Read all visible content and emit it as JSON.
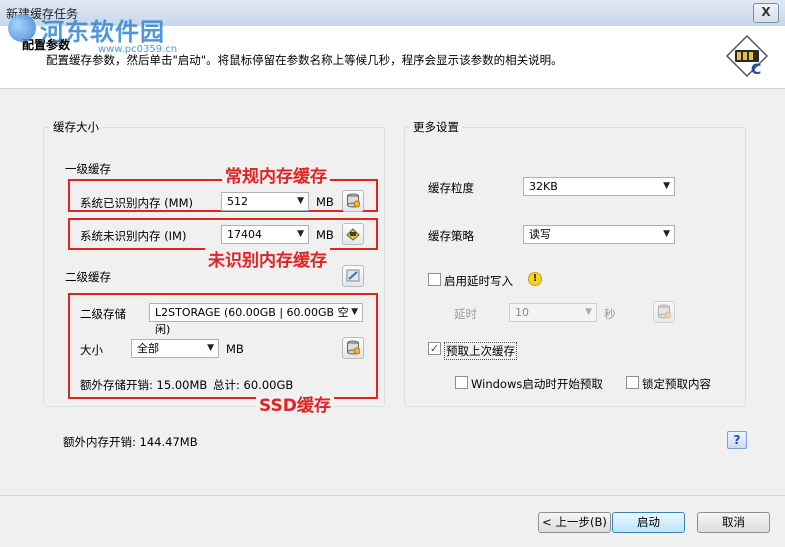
{
  "window": {
    "title": "新建缓存任务",
    "close_label": "X"
  },
  "watermark": {
    "text": "河东软件园",
    "sub": "www.pc0359.cn"
  },
  "header": {
    "title": "配置参数",
    "description": "配置缓存参数，然后单击\"启动\"。将鼠标停留在参数名称上等候几秒，程序会显示该参数的相关说明。",
    "icon": "cache-card-icon"
  },
  "cache_size": {
    "group_title": "缓存大小",
    "level1_label": "一级缓存",
    "recognized_label": "系统已识别内存 (MM)",
    "recognized_value": "512",
    "recognized_unit": "MB",
    "unrecognized_label": "系统未识别内存 (IM)",
    "unrecognized_value": "17404",
    "unrecognized_unit": "MB",
    "level2_label": "二级缓存",
    "storage_label": "二级存储",
    "storage_value": "L2STORAGE (60.00GB | 60.00GB 空闲)",
    "size_label": "大小",
    "size_value": "全部",
    "size_unit": "MB",
    "extra_storage_text": "额外存储开销: 15.00MB",
    "total_text": "总计: 60.00GB"
  },
  "annotations": {
    "regular_memory": "常规内存缓存",
    "unrecognized_memory": "未识别内存缓存",
    "ssd": "SSD缓存"
  },
  "more_settings": {
    "group_title": "更多设置",
    "granularity_label": "缓存粒度",
    "granularity_value": "32KB",
    "strategy_label": "缓存策略",
    "strategy_value": "读写",
    "delayed_write_label": "启用延时写入",
    "delayed_write_checked": false,
    "delay_label": "延时",
    "delay_value": "10",
    "delay_unit": "秒",
    "prefetch_label": "预取上次缓存",
    "prefetch_checked": true,
    "windows_start_label": "Windows启动时开始预取",
    "windows_start_checked": false,
    "lock_prefetch_label": "锁定预取内容",
    "lock_prefetch_checked": false
  },
  "extra_memory_text": "额外内存开销: 144.47MB",
  "help_label": "?",
  "footer": {
    "back_label": "< 上一步(B)",
    "start_label": "启动",
    "cancel_label": "取消"
  },
  "colors": {
    "annotation_red": "#e02424",
    "accent_blue": "#2f87d8"
  }
}
